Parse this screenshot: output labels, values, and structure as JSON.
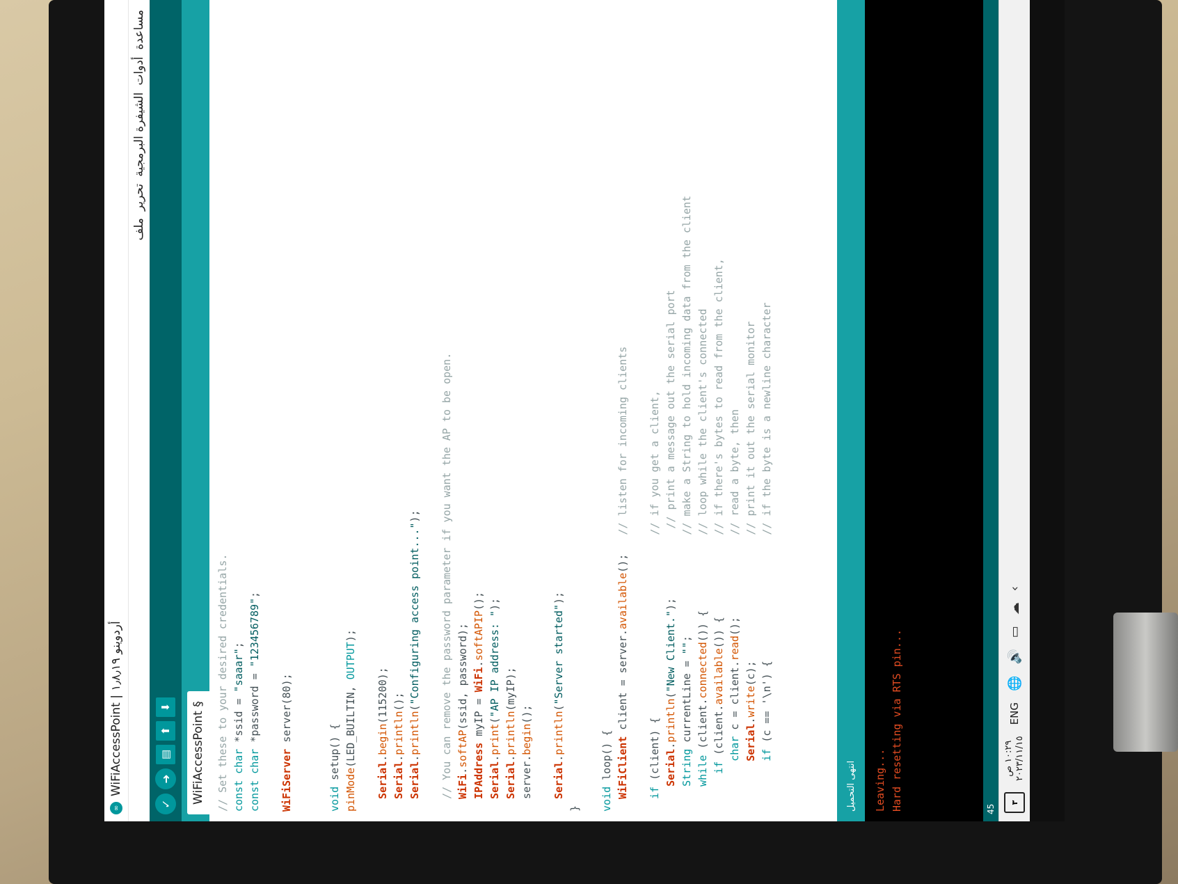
{
  "window": {
    "title": "WiFiAccessPoint | أردوينو ١٫٨٫١٩",
    "app_icon": "arduino-icon"
  },
  "menu": [
    "ملف",
    "تحرير",
    "الشيفرة البرمجية",
    "أدوات",
    "مساعدة"
  ],
  "toolbar": {
    "verify_icon": "check-icon",
    "upload_icon": "arrow-right-icon",
    "new_icon": "new-file-icon",
    "open_icon": "arrow-up-icon",
    "save_icon": "arrow-down-icon"
  },
  "tab": {
    "label": "WiFiAccessPoint §"
  },
  "code_lines": [
    "// Set these to your desired credentials.",
    "const char *ssid = \"saaar\";",
    "const char *password = \"123456789\";",
    "",
    "WiFiServer server(80);",
    "",
    "",
    "void setup() {",
    "pinMode(LED_BUILTIN, OUTPUT);",
    "",
    "  Serial.begin(115200);",
    "  Serial.println();",
    "  Serial.println(\"Configuring access point...\");",
    "",
    "  // You can remove the password parameter if you want the AP to be open.",
    "  WiFi.softAP(ssid, password);",
    "  IPAddress myIP = WiFi.softAPIP();",
    "  Serial.print(\"AP IP address: \");",
    "  Serial.println(myIP);",
    "  server.begin();",
    "",
    "  Serial.println(\"Server started\");",
    "}",
    "",
    "void loop() {",
    "  WiFiClient client = server.available();   // listen for incoming clients",
    "",
    "  if (client) {                             // if you get a client,",
    "    Serial.println(\"New Client.\");           // print a message out the serial port",
    "    String currentLine = \"\";                // make a String to hold incoming data from the client",
    "    while (client.connected()) {            // loop while the client's connected",
    "      if (client.available()) {             // if there's bytes to read from the client,",
    "        char c = client.read();             // read a byte, then",
    "        Serial.write(c);                    // print it out the serial monitor",
    "        if (c == '\\n') {                    // if the byte is a newline character"
  ],
  "status": {
    "text": "انتهى التحميل"
  },
  "console": {
    "lines": [
      "Leaving...",
      "Hard resetting via RTS pin..."
    ]
  },
  "bottom_bar": {
    "line_number": "45"
  },
  "taskbar": {
    "clock_time": "١٠:٢٩ ص",
    "clock_date": "٢٠٢٣/١١/١٥",
    "language": "ENG",
    "globe_icon": "globe-icon",
    "volume_icon": "volume-icon",
    "battery_icon": "battery-icon",
    "cloud_icon": "cloud-icon",
    "chevron_icon": "chevron-up-icon",
    "notification_count": "٣"
  }
}
